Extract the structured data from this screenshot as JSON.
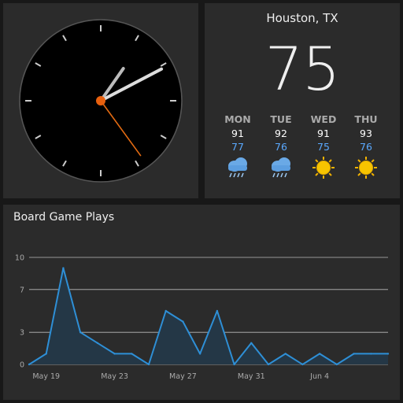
{
  "clock": {
    "time": "13:10:24"
  },
  "weather": {
    "city": "Houston, TX",
    "current_temp": "75",
    "forecast": [
      {
        "day": "MON",
        "high": "91",
        "low": "77",
        "icon": "rain-cloud-icon"
      },
      {
        "day": "TUE",
        "high": "92",
        "low": "76",
        "icon": "rain-cloud-icon"
      },
      {
        "day": "WED",
        "high": "91",
        "low": "75",
        "icon": "sun-icon"
      },
      {
        "day": "THU",
        "high": "93",
        "low": "76",
        "icon": "sun-icon"
      }
    ]
  },
  "chart_data": {
    "type": "area",
    "title": "Board Game Plays",
    "x": [
      "May 18",
      "May 19",
      "May 20",
      "May 21",
      "May 22",
      "May 23",
      "May 24",
      "May 25",
      "May 26",
      "May 27",
      "May 28",
      "May 29",
      "May 30",
      "May 31",
      "Jun 1",
      "Jun 2",
      "Jun 3",
      "Jun 4",
      "Jun 5",
      "Jun 6",
      "Jun 7",
      "Jun 8"
    ],
    "values": [
      0,
      1,
      9,
      3,
      2,
      1,
      1,
      0,
      5,
      4,
      1,
      5,
      0,
      2,
      0,
      1,
      0,
      1,
      0,
      1,
      1,
      1
    ],
    "x_tick_labels": [
      "May 19",
      "May 23",
      "May 27",
      "May 31",
      "Jun 4"
    ],
    "y_tick_labels": [
      "0",
      "3",
      "7",
      "10"
    ],
    "ylim": [
      0,
      10
    ],
    "grid": true,
    "colors": {
      "line": "#2e8fd6",
      "fill": "#243746",
      "grid": "#bbbbbb"
    }
  }
}
